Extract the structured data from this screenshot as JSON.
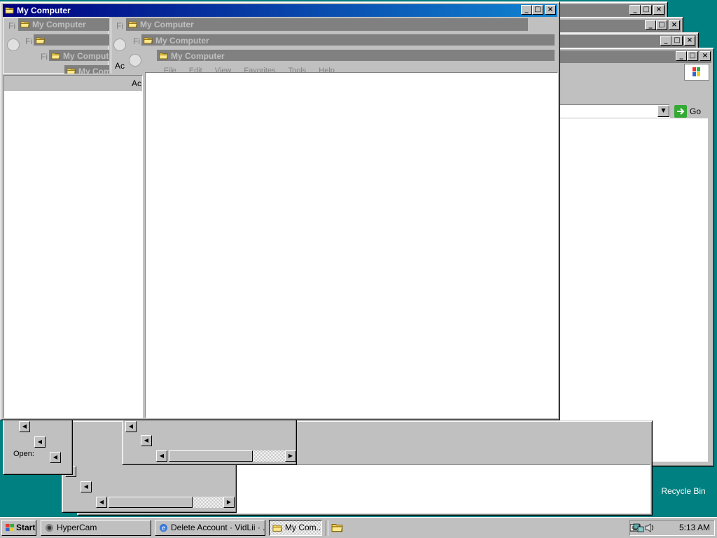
{
  "desktop": {
    "recycle_bin_label": "Recycle Bin",
    "open_label": "Open:",
    "background_color": "#008080"
  },
  "windows": {
    "title": "My Computer",
    "menu": [
      "File",
      "Edit",
      "View",
      "Favorites",
      "Tools",
      "Help"
    ],
    "address_fragment": "Ac",
    "menu_fragment": "Fi",
    "go_label": "Go"
  },
  "taskbar": {
    "start_label": "Start",
    "buttons": [
      {
        "label": "HyperCam",
        "icon": "hypercam-icon"
      },
      {
        "label": "Delete Account · VidLii · ...",
        "icon": "ie-icon"
      },
      {
        "label": "My Com...",
        "icon": "folder-icon"
      }
    ],
    "clock": "5:13 AM"
  },
  "colors": {
    "active_title_start": "#000080",
    "active_title_end": "#1084d0",
    "inactive_title": "#808080",
    "face": "#c0c0c0"
  }
}
